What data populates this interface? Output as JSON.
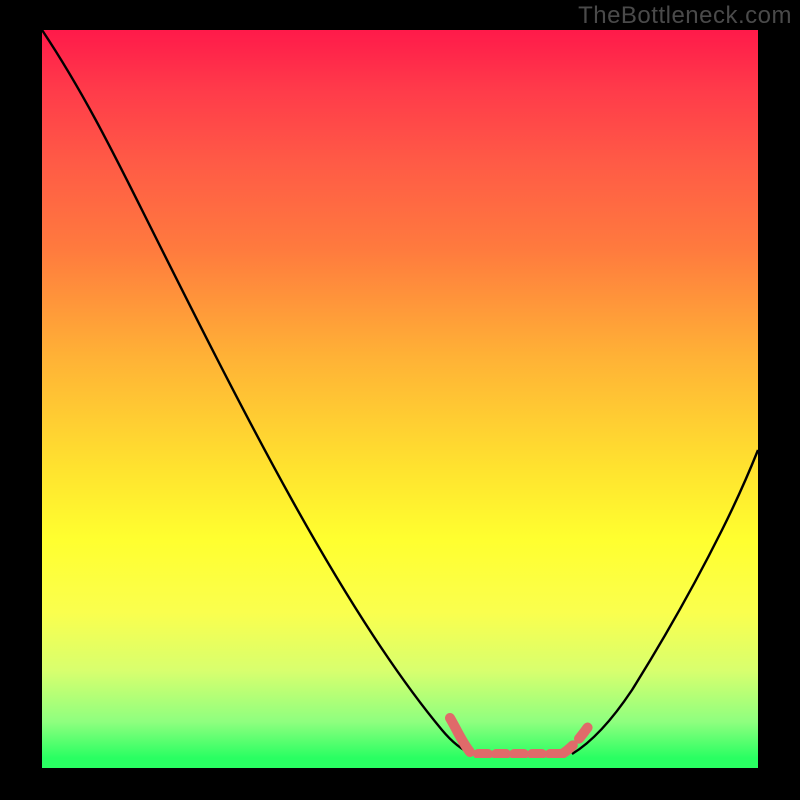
{
  "watermark": "TheBottleneck.com",
  "chart_data": {
    "type": "line",
    "title": "",
    "xlabel": "",
    "ylabel": "",
    "xlim": [
      0,
      100
    ],
    "ylim": [
      0,
      100
    ],
    "series": [
      {
        "name": "bottleneck-curve",
        "x": [
          0,
          5,
          10,
          15,
          20,
          25,
          30,
          35,
          40,
          45,
          50,
          55,
          58,
          60,
          62,
          64,
          66,
          68,
          70,
          72,
          75,
          80,
          85,
          90,
          95,
          100
        ],
        "values": [
          100,
          95,
          89,
          82,
          75,
          67,
          59,
          51,
          43,
          35,
          27,
          19,
          12,
          8,
          4,
          2,
          1,
          1,
          1,
          2,
          4,
          10,
          18,
          27,
          37,
          47
        ]
      }
    ],
    "annotations": [
      {
        "name": "sweet-spot-band",
        "x_start": 58,
        "x_end": 74,
        "style": "dashed-pink"
      }
    ],
    "background_gradient": {
      "0": "#ff1a4a",
      "50": "#ffe22f",
      "100": "#29ff62"
    }
  }
}
